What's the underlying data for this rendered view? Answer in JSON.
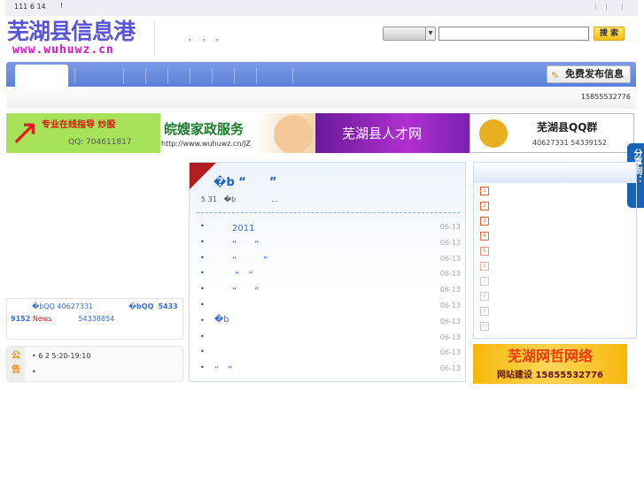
{
  "topbar": {
    "date": "111 6 14",
    "exclaim": "!",
    "separators": [
      "|",
      "|",
      "|"
    ]
  },
  "logo": {
    "name": "芜湖县信息港",
    "url": "www.wuhuwz.cn"
  },
  "header": {
    "dots": [
      "，",
      "，",
      "，"
    ]
  },
  "search": {
    "select_value": "",
    "input_value": "",
    "button": "搜 索"
  },
  "nav": {
    "publish": "免费发布信息"
  },
  "subbar": {
    "phone": "15855532776"
  },
  "banners": [
    {
      "title": "专业在线指导 炒股",
      "qq": "QQ: 704611817"
    },
    {
      "title": "皖嫂家政服务",
      "url": "http://www.wuhuwz.cn/JZ"
    },
    {
      "title": "芜湖县人才网"
    },
    {
      "title": "芜湖县QQ群",
      "numbers": "40627331  54339152"
    }
  ],
  "share": {
    "label": "分享到：",
    "dots": "…"
  },
  "qqbox": {
    "l1a": "�bQQ",
    "l1b": "40627331",
    "l1c": "�bQQ",
    "l1d": "5433",
    "l2a": "9152",
    "l2b": "News",
    "l2c": "54338854"
  },
  "notice": {
    "label1": "公",
    "label2": "告",
    "items": [
      "6 2 5:20-19:10",
      ""
    ]
  },
  "center": {
    "headline": "�b “　　”",
    "summary": "5 31　�b　　　　　…",
    "items": [
      {
        "text": "　　2011",
        "date": "06-13"
      },
      {
        "text": "　　“　　”",
        "date": "06-13"
      },
      {
        "text": "　　“　　　”",
        "date": "06-13"
      },
      {
        "text": "　　 “　”",
        "date": "06-13"
      },
      {
        "text": "　　“　　”",
        "date": "06-13"
      },
      {
        "text": "",
        "date": "06-13"
      },
      {
        "text": "�b",
        "date": "06-13"
      },
      {
        "text": "",
        "date": "06-13"
      },
      {
        "text": "",
        "date": "06-13"
      },
      {
        "text": "“　”",
        "date": "06-13"
      }
    ]
  },
  "right": {
    "ranks": [
      "1",
      "2",
      "3",
      "4",
      "5",
      "6",
      "7",
      "8",
      "9",
      "10"
    ]
  },
  "ad": {
    "title": "芜湖网哲网络",
    "subtitle": "网站建设 15855532776"
  }
}
